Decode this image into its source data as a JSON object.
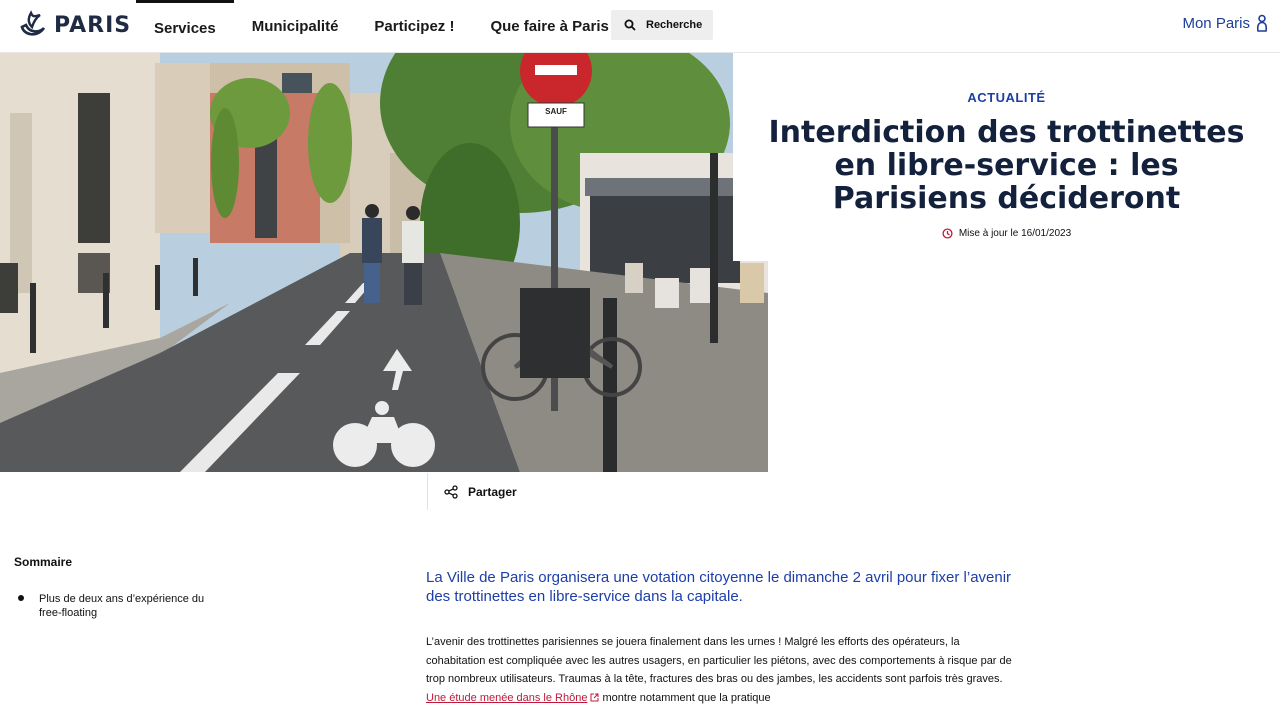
{
  "header": {
    "logo_text": "PARIS",
    "nav": [
      "Services",
      "Municipalité",
      "Participez !",
      "Que faire à Paris ?"
    ],
    "search_label": "Recherche",
    "account_label": "Mon Paris"
  },
  "article": {
    "kicker": "ACTUALITÉ",
    "title": "Interdiction des trottinettes en libre-service : les Parisiens décideront",
    "updated": "Mise à jour le 16/01/2023",
    "share_label": "Partager",
    "lead": "La Ville de Paris organisera une votation citoyenne le dimanche 2 avril pour fixer l’avenir des trottinettes en libre-service dans la capitale.",
    "body_before_link": "L’avenir des trottinettes parisiennes se jouera finalement dans les urnes ! Malgré les efforts des opérateurs, la cohabitation est compliquée avec les autres usagers, en particulier les piétons, avec des comportements à risque par de trop nombreux utilisateurs. Traumas à la tête, fractures des bras ou des jambes, les accidents sont parfois très graves. ",
    "body_link": "Une étude menée dans le Rhône",
    "body_after_link": " montre notamment que la pratique"
  },
  "hero": {
    "sign_text": "SAUF"
  },
  "sommaire": {
    "title": "Sommaire",
    "items": [
      "Plus de deux ans d’expérience du free-floating"
    ]
  },
  "colors": {
    "accent_blue": "#1d3ea8",
    "title_navy": "#14213d",
    "link_red": "#c1193a",
    "clock_red": "#c1193a"
  }
}
